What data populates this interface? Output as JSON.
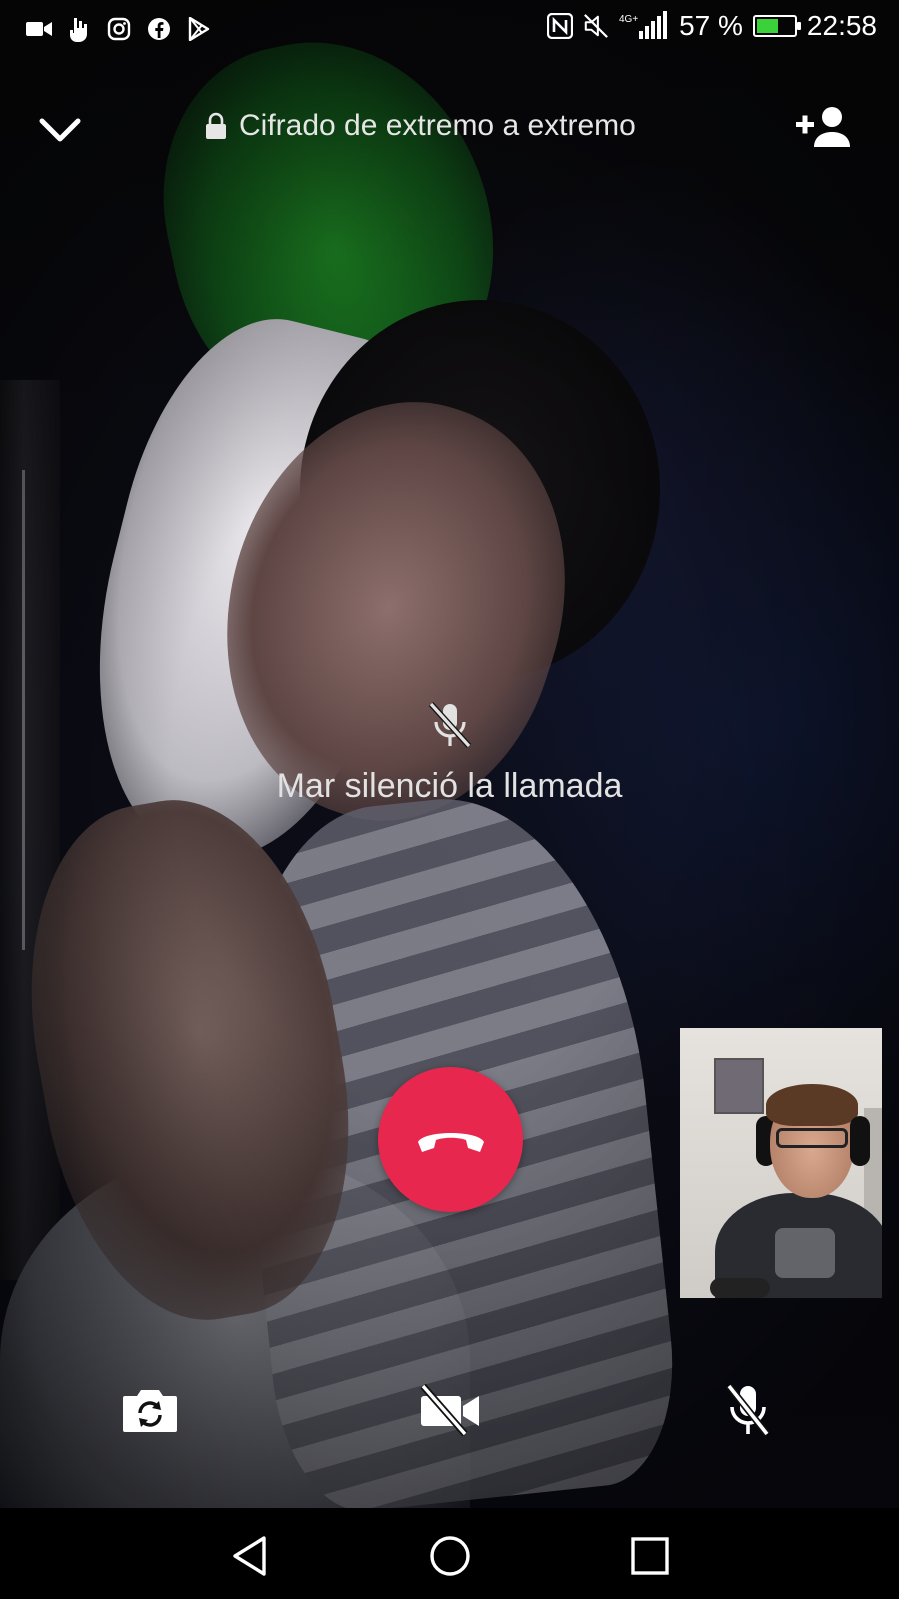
{
  "status_bar": {
    "left_icons": [
      "video-camera-icon",
      "hand-icon",
      "instagram-icon",
      "facebook-icon",
      "play-store-icon"
    ],
    "right_icons": [
      "nfc-icon",
      "mute-sound-icon",
      "signal-icon"
    ],
    "network": "4G+",
    "battery_percent": "57 %",
    "battery_level": 0.57,
    "time": "22:58",
    "battery_color": "#3ad13a"
  },
  "header": {
    "encryption_label": "Cifrado de extremo a extremo"
  },
  "notice": {
    "muted_text": "Mar silenció la llamada"
  },
  "colors": {
    "end_call": "#e8274e",
    "text": "#e6e6e6"
  },
  "controls": {
    "buttons": [
      "flip-camera",
      "video-off",
      "mute-microphone"
    ]
  },
  "nav_bar": {
    "buttons": [
      "back",
      "home",
      "recents"
    ]
  }
}
